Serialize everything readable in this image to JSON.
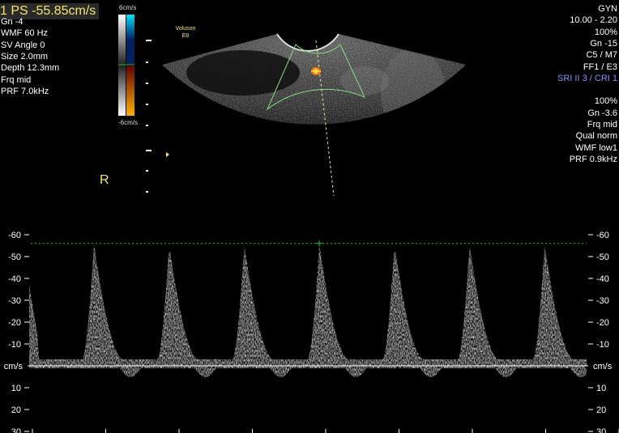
{
  "top_left": {
    "ps_readout": "1 PS -55.85cm/s",
    "params": [
      "Gn -4",
      "WMF 60 Hz",
      "SV Angle 0",
      "Size 2.0mm",
      "Depth 12.3mm",
      "Frq mid",
      "PRF 7.0kHz"
    ]
  },
  "color_scale": {
    "top": "6cm/s",
    "bottom": "-6cm/s"
  },
  "brand": {
    "line1": "Voluson",
    "line2": "E8"
  },
  "orientation_mark": "R",
  "top_right": {
    "params": [
      {
        "text": "GYN",
        "color": "white"
      },
      {
        "text": "10.00 - 2.20",
        "color": "white"
      },
      {
        "text": "100%",
        "color": "white"
      },
      {
        "text": "Gn -15",
        "color": "white"
      },
      {
        "text": "C5 / M7",
        "color": "white"
      },
      {
        "text": "FF1 / E3",
        "color": "white"
      },
      {
        "text": "SRI II 3 / CRI 1",
        "color": "blue"
      },
      {
        "text": "",
        "color": "white"
      },
      {
        "text": "100%",
        "color": "white"
      },
      {
        "text": "Gn -3.6",
        "color": "white"
      },
      {
        "text": "Frq mid",
        "color": "white"
      },
      {
        "text": "Qual norm",
        "color": "white"
      },
      {
        "text": "WMF low1",
        "color": "white"
      },
      {
        "text": "PRF 0.9kHz",
        "color": "white"
      }
    ]
  },
  "doppler_axis": {
    "unit": "cm/s",
    "ticks": [
      "-60",
      "-50",
      "-40",
      "-30",
      "-20",
      "-10",
      "10",
      "20",
      "30"
    ]
  },
  "colors": {
    "readout": "#f2e56a",
    "cursor": "#26c026",
    "label_blue": "#8c8cff"
  },
  "chart_data": {
    "type": "line",
    "ylabel": "cm/s",
    "ylim": [
      30,
      -60
    ],
    "peak_velocity": -55.85,
    "cycle_count": 7
  }
}
